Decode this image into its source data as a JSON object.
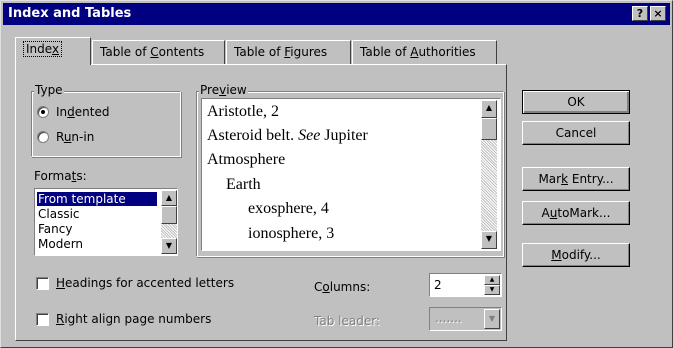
{
  "dialog": {
    "title": "Index and Tables",
    "help_label": "?",
    "close_label": "×"
  },
  "tabs": [
    {
      "pre": "Inde",
      "mn": "x",
      "post": "",
      "active": true
    },
    {
      "pre": "Table of ",
      "mn": "C",
      "post": "ontents"
    },
    {
      "pre": "Table of ",
      "mn": "F",
      "post": "igures"
    },
    {
      "pre": "Table of ",
      "mn": "A",
      "post": "uthorities"
    }
  ],
  "type_group": {
    "legend": "Type",
    "options": [
      {
        "pre": "In",
        "mn": "d",
        "post": "ented",
        "selected": true
      },
      {
        "pre": "R",
        "mn": "u",
        "post": "n-in",
        "selected": false
      }
    ]
  },
  "formats": {
    "label_pre": "Forma",
    "label_mn": "t",
    "label_post": "s:",
    "items": [
      "From template",
      "Classic",
      "Fancy",
      "Modern"
    ],
    "selected": "From template"
  },
  "preview": {
    "legend_pre": "Pre",
    "legend_mn": "v",
    "legend_post": "iew",
    "lines": [
      {
        "text": "Aristotle, 2"
      },
      {
        "pre": "Asteroid belt. ",
        "italic": "See",
        "post": " Jupiter"
      },
      {
        "text": "Atmosphere"
      },
      {
        "text": "Earth"
      },
      {
        "text": "exosphere, 4"
      },
      {
        "text": "ionosphere, 3"
      }
    ]
  },
  "buttons": {
    "ok": "OK",
    "cancel": "Cancel",
    "mark_entry": {
      "pre": "Mar",
      "mn": "k",
      "post": " Entry..."
    },
    "automark": {
      "pre": "A",
      "mn": "u",
      "post": "toMark..."
    },
    "modify": {
      "pre": "",
      "mn": "M",
      "post": "odify..."
    }
  },
  "options": {
    "headings": {
      "pre": "",
      "mn": "H",
      "post": "eadings for accented letters",
      "checked": false
    },
    "right_align": {
      "pre": "",
      "mn": "R",
      "post": "ight align page numbers",
      "checked": false
    }
  },
  "columns": {
    "label_pre": "C",
    "label_mn": "o",
    "label_post": "lumns:",
    "value": "2"
  },
  "tab_leader": {
    "label": "Tab leader:",
    "value": ".......",
    "disabled": true
  },
  "icons": [
    "up-arrow",
    "down-arrow",
    "help",
    "close"
  ]
}
